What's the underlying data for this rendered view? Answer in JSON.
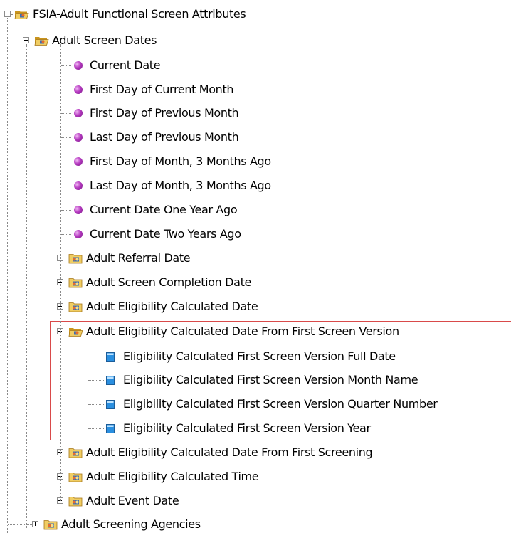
{
  "tree": {
    "root": {
      "label": "FSIA-Adult Functional Screen Attributes",
      "expanded": true,
      "children": {
        "screen_dates": {
          "label": "Adult Screen Dates",
          "expanded": true,
          "items": [
            "Current Date",
            "First Day of Current Month",
            "First Day of Previous Month",
            "Last Day of Previous Month",
            "First Day of Month, 3 Months Ago",
            "Last Day of Month, 3 Months Ago",
            "Current Date One Year Ago",
            "Current Date Two Years Ago"
          ],
          "subfolders": [
            {
              "label": "Adult Referral Date",
              "expanded": false
            },
            {
              "label": "Adult Screen Completion Date",
              "expanded": false
            },
            {
              "label": "Adult Eligibility Calculated Date",
              "expanded": false
            },
            {
              "label": "Adult Eligibility Calculated Date From First Screen Version",
              "expanded": true,
              "highlighted": true,
              "attributes": [
                "Eligibility Calculated First Screen Version Full Date",
                "Eligibility Calculated First Screen Version Month Name",
                "Eligibility Calculated First Screen Version Quarter Number",
                "Eligibility Calculated First Screen Version Year"
              ]
            },
            {
              "label": "Adult Eligibility Calculated Date From First Screening",
              "expanded": false
            },
            {
              "label": "Adult Eligibility Calculated Time",
              "expanded": false
            },
            {
              "label": "Adult Event Date",
              "expanded": false
            }
          ]
        },
        "screening_agencies": {
          "label": "Adult Screening Agencies",
          "expanded": false
        }
      }
    }
  },
  "icons": {
    "expanded_folder": "open-folder-icon",
    "collapsed_folder": "closed-folder-icon",
    "prompt_item": "purple-bullet-icon",
    "attribute_item": "blue-attribute-icon"
  },
  "colors": {
    "highlight_border": "#d94a4a",
    "bullet": "#b53ac0",
    "attribute": "#2a8fe0",
    "folder": "#e8c25a"
  }
}
